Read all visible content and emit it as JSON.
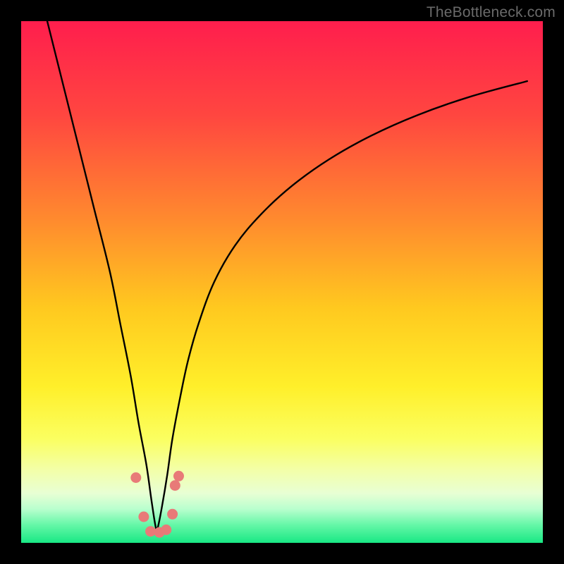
{
  "watermark": "TheBottleneck.com",
  "colors": {
    "bg_black": "#000000",
    "curve_stroke": "#000000",
    "dot_fill": "#e87a78",
    "watermark_text": "#6a6a6a",
    "gradient_stops": [
      {
        "offset": 0.0,
        "color": "#ff1e4d"
      },
      {
        "offset": 0.18,
        "color": "#ff4640"
      },
      {
        "offset": 0.38,
        "color": "#ff8a2e"
      },
      {
        "offset": 0.55,
        "color": "#ffc91f"
      },
      {
        "offset": 0.7,
        "color": "#ffef2a"
      },
      {
        "offset": 0.8,
        "color": "#fbff60"
      },
      {
        "offset": 0.86,
        "color": "#f3ffa8"
      },
      {
        "offset": 0.905,
        "color": "#e8ffd4"
      },
      {
        "offset": 0.935,
        "color": "#b9ffce"
      },
      {
        "offset": 0.965,
        "color": "#66f7a8"
      },
      {
        "offset": 1.0,
        "color": "#18e884"
      }
    ]
  },
  "chart_data": {
    "type": "line",
    "title": "",
    "xlabel": "",
    "ylabel": "",
    "xlim": [
      0,
      100
    ],
    "ylim": [
      0,
      100
    ],
    "grid": false,
    "series": [
      {
        "name": "bottleneck-curve",
        "x": [
          5,
          8,
          11,
          14,
          17,
          19,
          21,
          22.5,
          24,
          25,
          25.8,
          26.2,
          27,
          28,
          29,
          30.5,
          32,
          34,
          37,
          41,
          46,
          52,
          59,
          67,
          76,
          86,
          97
        ],
        "y": [
          100,
          88,
          76,
          64,
          52,
          42,
          32,
          23,
          15,
          8,
          3,
          3,
          7,
          13,
          20,
          28,
          35,
          42,
          50,
          57,
          63,
          68.5,
          73.5,
          78,
          82,
          85.5,
          88.5
        ]
      }
    ],
    "annotations": {
      "dots": [
        {
          "x": 22.0,
          "y": 12.5
        },
        {
          "x": 23.5,
          "y": 5.0
        },
        {
          "x": 24.8,
          "y": 2.2
        },
        {
          "x": 26.5,
          "y": 2.0
        },
        {
          "x": 27.8,
          "y": 2.5
        },
        {
          "x": 29.0,
          "y": 5.5
        },
        {
          "x": 29.5,
          "y": 11.0
        },
        {
          "x": 30.2,
          "y": 12.8
        }
      ]
    },
    "legend": false
  }
}
